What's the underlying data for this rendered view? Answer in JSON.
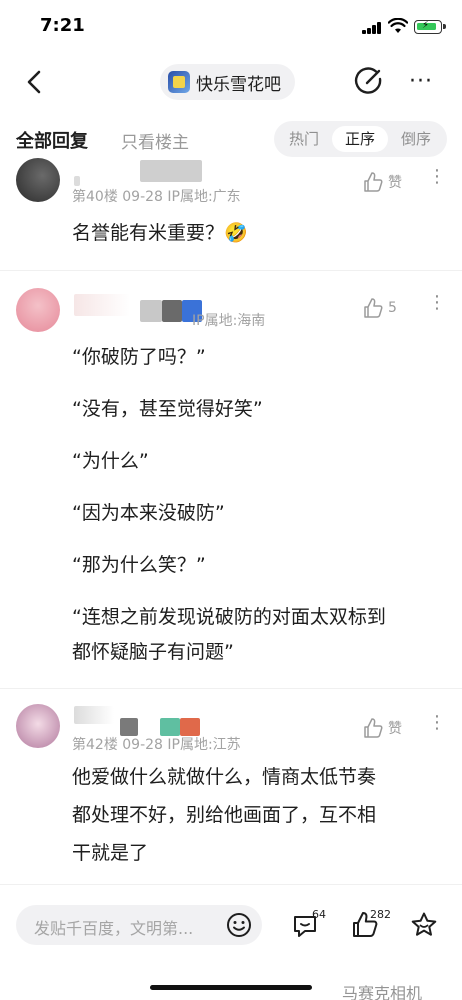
{
  "status": {
    "time": "7:21"
  },
  "nav": {
    "forum_name": "快乐雪花吧"
  },
  "tabs": {
    "all_replies": "全部回复",
    "op_only": "只看楼主",
    "sort": [
      "热门",
      "正序",
      "倒序"
    ],
    "sort_selected": "正序"
  },
  "posts": [
    {
      "meta": "第40楼  09-28  IP属地:广东",
      "likes": "赞",
      "lines": [
        "名誉能有米重要？🤣"
      ]
    },
    {
      "meta": "IP属地:海南",
      "likes": "5",
      "lines": [
        "“你破防了吗？”",
        "“没有，甚至觉得好笑”",
        "“为什么”",
        "“因为本来没破防”",
        "“那为什么笑？”",
        "“连想之前发现说破防的对面太双标到",
        "都怀疑脑子有问题”"
      ]
    },
    {
      "meta": "第42楼  09-28  IP属地:江苏",
      "likes": "赞",
      "lines": [
        "他爱做什么就做什么，情商太低节奏",
        "都处理不好，别给他画面了，互不相",
        "干就是了"
      ]
    }
  ],
  "bottom": {
    "placeholder": "发贴千百度，文明第...",
    "comment_count": "64",
    "like_count": "282"
  },
  "watermark": "马赛克相机",
  "colors": {
    "accent_battery": "#34c759",
    "muted_text": "#a3a3a3"
  }
}
